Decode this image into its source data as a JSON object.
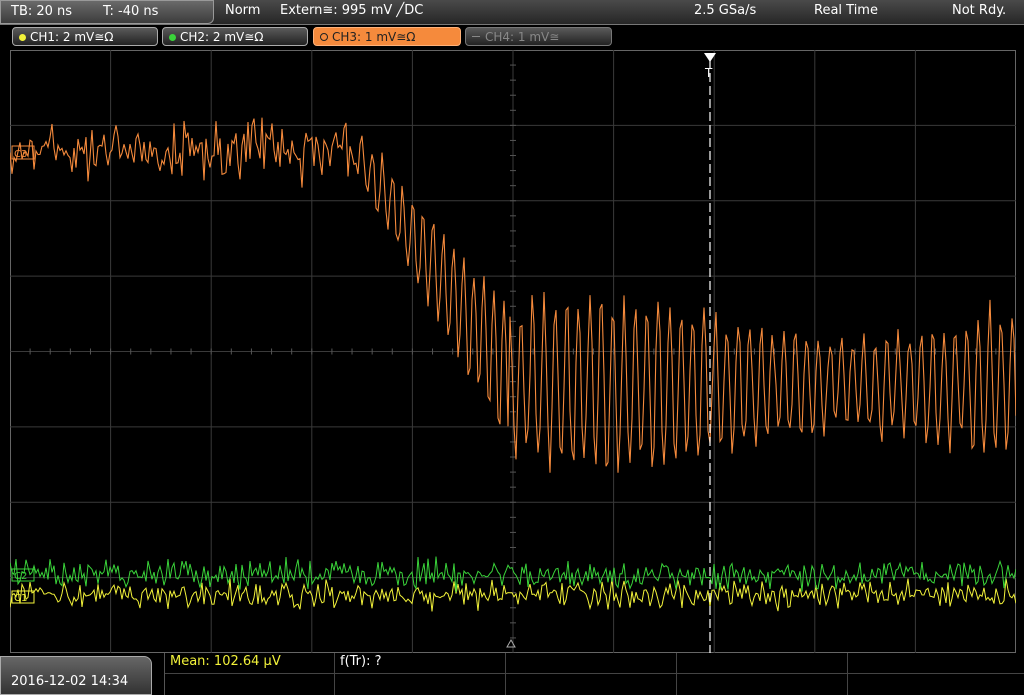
{
  "header": {
    "timebase": "TB: 20 ns",
    "trigger_time": "T: -40 ns",
    "trigger_mode": "Norm",
    "trigger_source": "Extern≅: 995 mV ╱DC",
    "sample_rate": "2.5 GSa/s",
    "acq_mode": "Real Time",
    "status": "Not Rdy."
  },
  "channels": [
    {
      "label": "CH1: 2 mV≅Ω",
      "color": "#f2f23a",
      "state": "on"
    },
    {
      "label": "CH2: 2 mV≅Ω",
      "color": "#3ad43a",
      "state": "on"
    },
    {
      "label": "CH3: 1 mV≅Ω",
      "color": "#f58a3c",
      "state": "active"
    },
    {
      "label": "CH4: 1 mV≅",
      "color": "#888888",
      "state": "off"
    }
  ],
  "markers": {
    "ch3": "C3",
    "ch2": "C2",
    "ch1": "C1",
    "trigger": "T"
  },
  "measurements": {
    "mean": "Mean: 102.64 µV",
    "ftr": "f(Tr): ?"
  },
  "footer": {
    "datetime": "2016-12-02 14:34"
  },
  "colors": {
    "ch1": "#f2f23a",
    "ch2": "#3ad43a",
    "ch3": "#f58a3c",
    "grid": "#3a3a3a"
  }
}
